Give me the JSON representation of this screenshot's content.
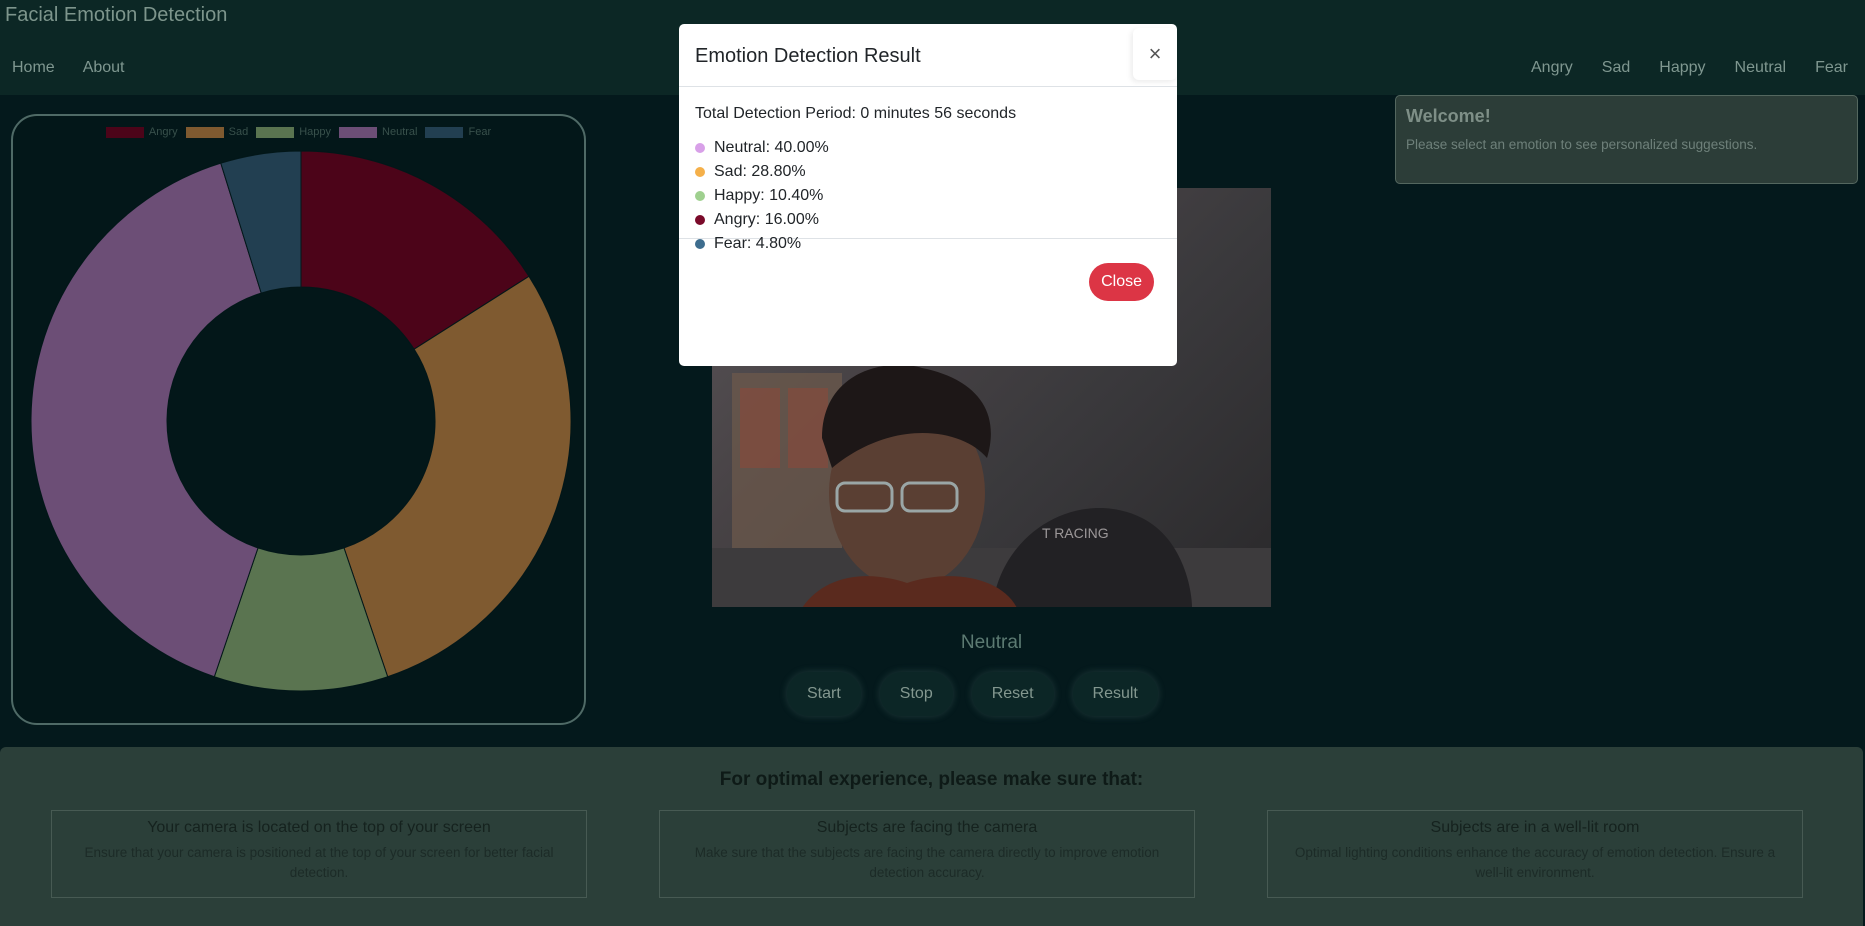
{
  "app": {
    "title": "Facial Emotion Detection"
  },
  "nav": {
    "left": [
      "Home",
      "About"
    ],
    "right": [
      "Angry",
      "Sad",
      "Happy",
      "Neutral",
      "Fear"
    ]
  },
  "welcome": {
    "title": "Welcome!",
    "text": "Please select an emotion to see personalized suggestions."
  },
  "chart_data": {
    "type": "pie",
    "variant": "doughnut",
    "categories": [
      "Angry",
      "Sad",
      "Happy",
      "Neutral",
      "Fear"
    ],
    "values": [
      16.0,
      28.8,
      10.4,
      40.0,
      4.8
    ],
    "colors": [
      "#4c0419",
      "#7f5a30",
      "#5a7450",
      "#6c4e76",
      "#223f51"
    ],
    "legend_position": "top"
  },
  "video": {
    "current_emotion": "Neutral"
  },
  "controls": {
    "start": "Start",
    "stop": "Stop",
    "reset": "Reset",
    "result": "Result"
  },
  "tips": {
    "heading": "For optimal experience, please make sure that:",
    "cards": [
      {
        "title": "Your camera is located on the top of your screen",
        "text": "Ensure that your camera is positioned at the top of your screen for better facial detection."
      },
      {
        "title": "Subjects are facing the camera",
        "text": "Make sure that the subjects are facing the camera directly to improve emotion detection accuracy."
      },
      {
        "title": "Subjects are in a well-lit room",
        "text": "Optimal lighting conditions enhance the accuracy of emotion detection. Ensure a well-lit environment."
      }
    ]
  },
  "modal": {
    "title": "Emotion Detection Result",
    "close_x": "×",
    "period": "Total Detection Period: 0 minutes 56 seconds",
    "stats": [
      {
        "text": "Neutral: 40.00%",
        "color": "#d8a0e8"
      },
      {
        "text": "Sad: 28.80%",
        "color": "#f5b04a"
      },
      {
        "text": "Happy: 10.40%",
        "color": "#9fd08f"
      },
      {
        "text": "Angry: 16.00%",
        "color": "#7a0a2a"
      },
      {
        "text": "Fear: 4.80%",
        "color": "#3e6d8e"
      }
    ],
    "close_button": "Close"
  },
  "colors": {
    "danger": "#dc3545",
    "background": "#04191c"
  }
}
